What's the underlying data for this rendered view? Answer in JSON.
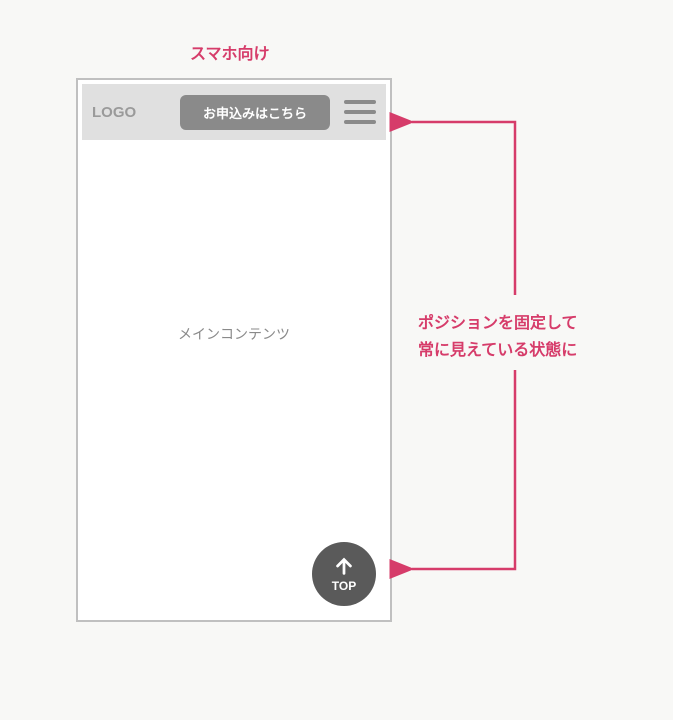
{
  "title": "スマホ向け",
  "header": {
    "logo": "LOGO",
    "cta_label": "お申込みはこちら"
  },
  "main": {
    "content_label": "メインコンテンツ"
  },
  "top_button": {
    "label": "TOP"
  },
  "annotation": {
    "line1": "ポジションを固定して",
    "line2": "常に見えている状態に"
  },
  "colors": {
    "accent": "#d63c6a",
    "gray": "#8a8a8a",
    "header_bg": "#e0e0e0",
    "top_button_bg": "#5a5a5a"
  }
}
